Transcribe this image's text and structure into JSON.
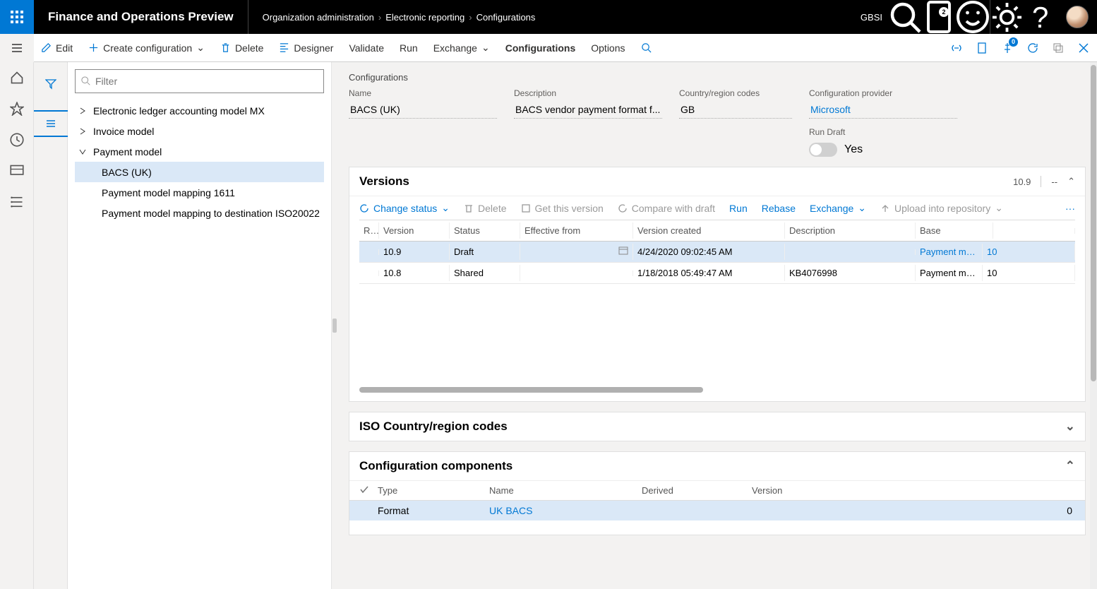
{
  "header": {
    "app_title": "Finance and Operations Preview",
    "breadcrumb": [
      "Organization administration",
      "Electronic reporting",
      "Configurations"
    ],
    "company": "GBSI",
    "notification_count": "2",
    "message_count": "0"
  },
  "actionbar": {
    "edit": "Edit",
    "create": "Create configuration",
    "delete": "Delete",
    "designer": "Designer",
    "validate": "Validate",
    "run": "Run",
    "exchange": "Exchange",
    "configurations": "Configurations",
    "options": "Options"
  },
  "tree": {
    "filter_placeholder": "Filter",
    "nodes": [
      {
        "label": "Electronic ledger accounting model MX",
        "expanded": false,
        "level": 0
      },
      {
        "label": "Invoice model",
        "expanded": false,
        "level": 0
      },
      {
        "label": "Payment model",
        "expanded": true,
        "level": 0
      },
      {
        "label": "BACS (UK)",
        "level": 1,
        "selected": true
      },
      {
        "label": "Payment model mapping 1611",
        "level": 1
      },
      {
        "label": "Payment model mapping to destination ISO20022",
        "level": 1
      }
    ]
  },
  "details": {
    "section_crumb": "Configurations",
    "name_label": "Name",
    "name": "BACS (UK)",
    "desc_label": "Description",
    "desc": "BACS vendor payment format f...",
    "region_label": "Country/region codes",
    "region": "GB",
    "provider_label": "Configuration provider",
    "provider": "Microsoft",
    "rundraft_label": "Run Draft",
    "rundraft_value": "Yes"
  },
  "versions": {
    "title": "Versions",
    "current": "10.9",
    "divider": "--",
    "toolbar": {
      "change_status": "Change status",
      "delete": "Delete",
      "get_version": "Get this version",
      "compare": "Compare with draft",
      "run": "Run",
      "rebase": "Rebase",
      "exchange": "Exchange",
      "upload": "Upload into repository"
    },
    "columns": [
      "R...",
      "Version",
      "Status",
      "Effective from",
      "Version created",
      "Description",
      "Base",
      ""
    ],
    "rows": [
      {
        "version": "10.9",
        "status": "Draft",
        "effective": "",
        "created": "4/24/2020 09:02:45 AM",
        "description": "",
        "base": "Payment model",
        "basenum": "10",
        "selected": true,
        "link": true
      },
      {
        "version": "10.8",
        "status": "Shared",
        "effective": "",
        "created": "1/18/2018 05:49:47 AM",
        "description": "KB4076998",
        "base": "Payment model",
        "basenum": "10",
        "selected": false,
        "link": false
      }
    ]
  },
  "iso": {
    "title": "ISO Country/region codes"
  },
  "components": {
    "title": "Configuration components",
    "columns": [
      "",
      "Type",
      "Name",
      "Derived",
      "Version"
    ],
    "row": {
      "type": "Format",
      "name": "UK BACS",
      "derived": "",
      "version": "0"
    }
  }
}
